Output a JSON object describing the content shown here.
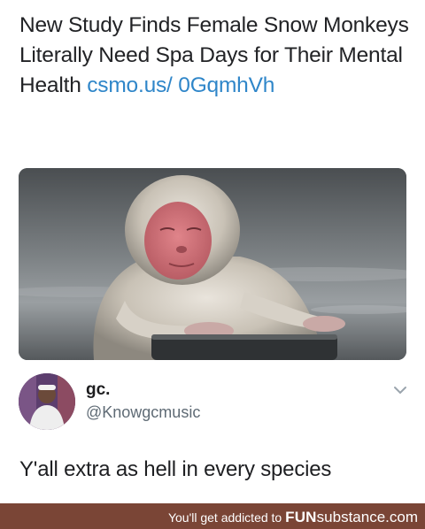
{
  "post": {
    "headline": "New Study Finds Female Snow Monkeys Literally Need Spa Days for Their Mental Health",
    "link": "csmo.us/ 0GqmhVh"
  },
  "author": {
    "display_name": "gc.",
    "handle": "@Knowgcmusic"
  },
  "reply": {
    "text": "Y'all extra as hell in every species"
  },
  "footer": {
    "tagline": "You'll get addicted to",
    "brand_bold": "FUN",
    "brand_rest": "substance.com"
  },
  "icons": {
    "menu": "chevron-down-icon"
  },
  "colors": {
    "link": "#2f86c9",
    "footer_bg": "#7a4536"
  }
}
